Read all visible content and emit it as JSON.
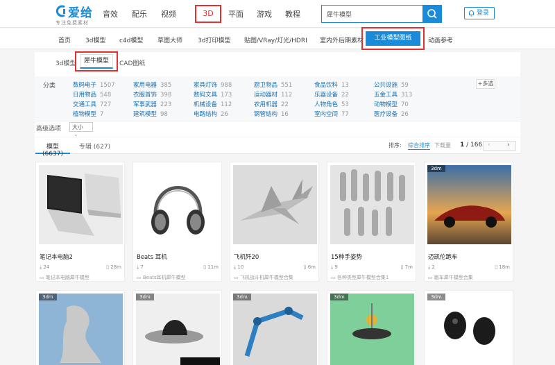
{
  "header": {
    "logo_text": "爱给",
    "logo_sub": "专注免费素材",
    "nav": [
      "音效",
      "配乐",
      "视频",
      "3D",
      "平面",
      "游戏",
      "教程"
    ],
    "search_value": "犀牛模型",
    "login": "登录"
  },
  "subnav": {
    "items": [
      "首页",
      "3d模型",
      "c4d模型",
      "草图大师",
      "3d打印模型",
      "贴图/VRay/灯光/HDRI",
      "室内外后期素材",
      "工业模型图纸",
      "动画参考"
    ]
  },
  "tabs": [
    "3d模型",
    "犀牛模型",
    "CAD图纸"
  ],
  "filter": {
    "label": "分类",
    "more": "+多选",
    "rows": [
      [
        [
          "数码电子",
          "1507"
        ],
        [
          "家用电器",
          "385"
        ],
        [
          "家具灯饰",
          "988"
        ],
        [
          "厨卫物品",
          "551"
        ],
        [
          "食品饮料",
          "13"
        ],
        [
          "公共设施",
          "59"
        ]
      ],
      [
        [
          "日用物品",
          "548"
        ],
        [
          "衣服首饰",
          "398"
        ],
        [
          "数码文具",
          "173"
        ],
        [
          "运动器材",
          "112"
        ],
        [
          "乐器设备",
          "22"
        ],
        [
          "五金工具",
          "313"
        ]
      ],
      [
        [
          "交通工具",
          "727"
        ],
        [
          "军事武器",
          "223"
        ],
        [
          "机械设备",
          "112"
        ],
        [
          "农用机器",
          "22"
        ],
        [
          "人物角色",
          "53"
        ],
        [
          "动物模型",
          "70"
        ]
      ],
      [
        [
          "植物模型",
          "7"
        ],
        [
          "建筑模型",
          "98"
        ],
        [
          "电路结构",
          "26"
        ],
        [
          "钢管结构",
          "16"
        ],
        [
          "室内空间",
          "77"
        ],
        [
          "医疗设备",
          "26"
        ]
      ]
    ],
    "adv_label": "高级选项",
    "size_label": "大小"
  },
  "results": {
    "model_tab": "模型 (6637)",
    "album_tab": "专辑 (627)",
    "sort_label": "排序:",
    "sort_comp": "综合排序",
    "sort_dl": "下载量",
    "page_current": "1",
    "page_total": "/ 166"
  },
  "cards": [
    {
      "title": "笔记本电脑2",
      "dl": "24",
      "size": "28m",
      "cat": "笔记本电脑犀牛模型",
      "badge": ""
    },
    {
      "title": "Beats 耳机",
      "dl": "7",
      "size": "11m",
      "cat": "Beats耳机犀牛模型",
      "badge": ""
    },
    {
      "title": "飞机歼20",
      "dl": "10",
      "size": "6m",
      "cat": "飞机战斗机犀牛模型合集",
      "badge": ""
    },
    {
      "title": "15种手姿势",
      "dl": "9",
      "size": "7m",
      "cat": "各种类型犀牛模型合集1",
      "badge": ""
    },
    {
      "title": "迈凯伦跑车",
      "dl": "2",
      "size": "18m",
      "cat": "跑车犀牛模型合集",
      "badge": "3dm"
    }
  ],
  "row2_badges": [
    "3dm",
    "3dm",
    "3dm",
    "3dm",
    "3dm"
  ]
}
